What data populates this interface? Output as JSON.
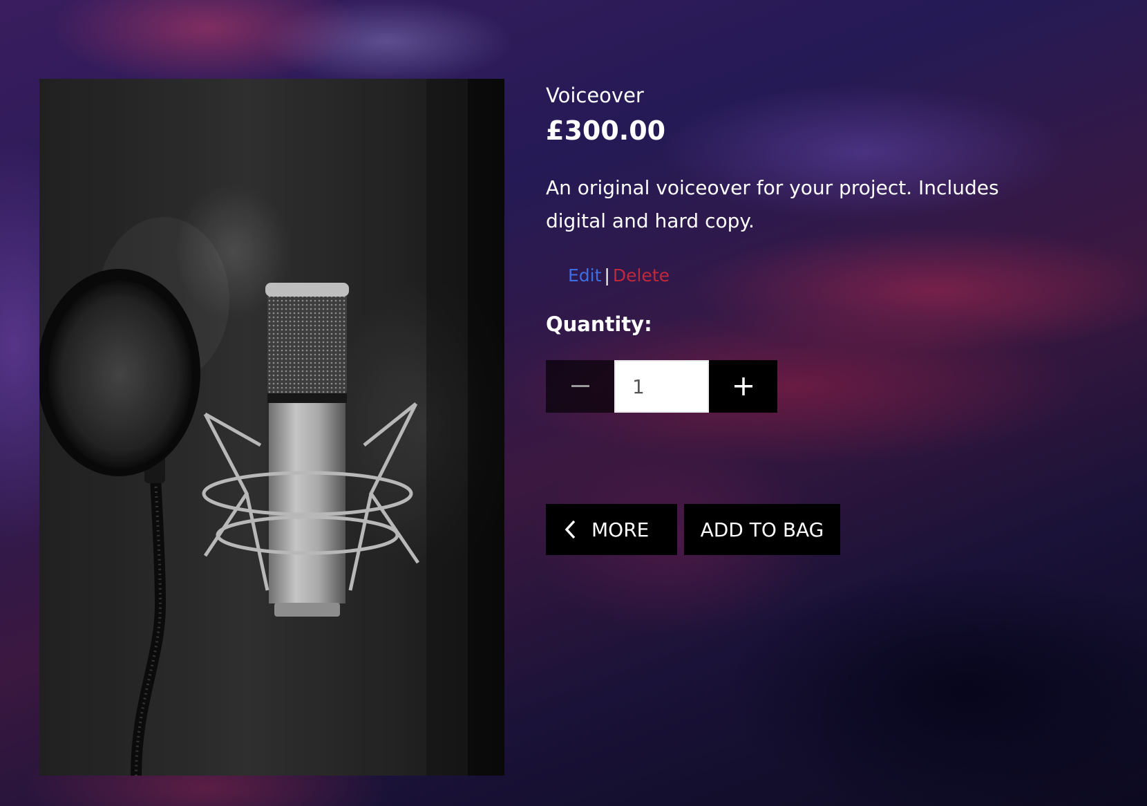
{
  "product": {
    "name": "Voiceover",
    "price": "£300.00",
    "description": "An original voiceover for your project. Includes digital and hard copy.",
    "image_icon": "microphone-photo"
  },
  "admin": {
    "edit_label": "Edit",
    "separator": "|",
    "delete_label": "Delete"
  },
  "quantity": {
    "label": "Quantity:",
    "value": "1",
    "decrement_icon": "minus-icon",
    "increment_icon": "plus-icon"
  },
  "actions": {
    "back_label": "MORE",
    "back_icon": "chevron-left-icon",
    "add_to_bag_label": "ADD TO BAG"
  },
  "colors": {
    "edit_link": "#3e6ee0",
    "delete_link": "#c0283c",
    "button_bg": "#000000"
  }
}
